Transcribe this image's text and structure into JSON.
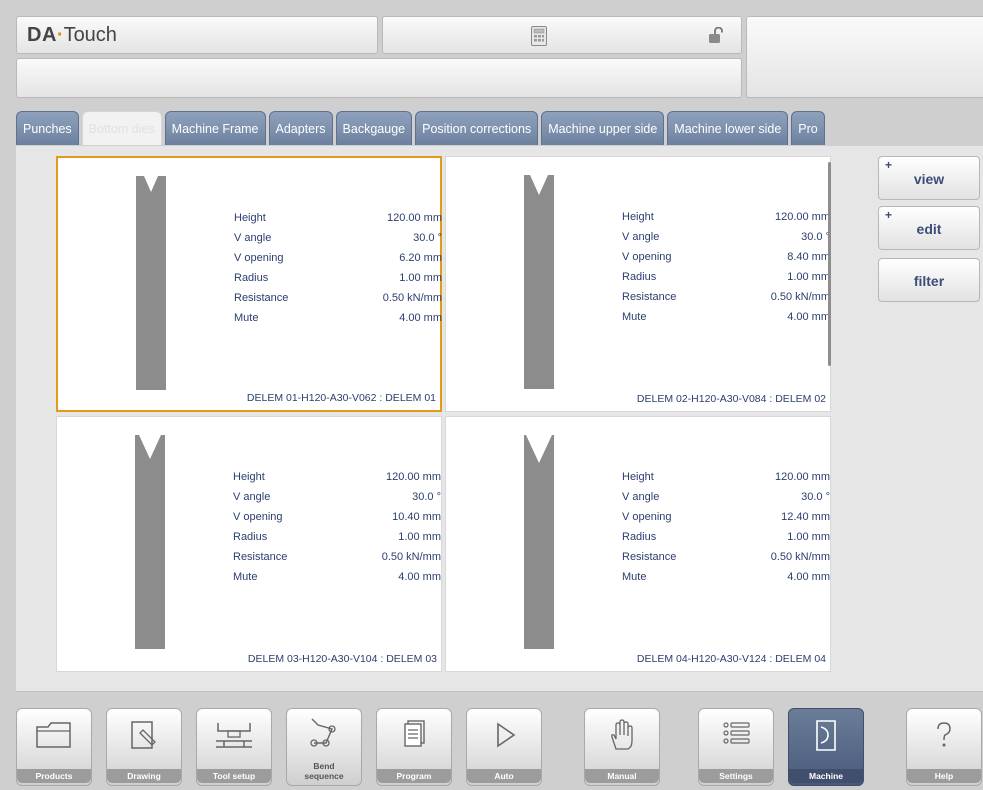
{
  "app": {
    "brand_prefix": "DA",
    "brand_separator": "·",
    "brand_suffix": "Touch"
  },
  "tabs": [
    {
      "label": "Punches"
    },
    {
      "label": "Bottom dies",
      "active": true
    },
    {
      "label": "Machine Frame"
    },
    {
      "label": "Adapters"
    },
    {
      "label": "Backgauge"
    },
    {
      "label": "Position corrections"
    },
    {
      "label": "Machine upper side"
    },
    {
      "label": "Machine lower side"
    },
    {
      "label": "Pro"
    }
  ],
  "prop_labels": {
    "height": "Height",
    "v_angle": "V angle",
    "v_opening": "V opening",
    "radius": "Radius",
    "resistance": "Resistance",
    "mute": "Mute"
  },
  "dies": [
    {
      "height": "120.00 mm",
      "v_angle": "30.0 °",
      "v_opening": "6.20 mm",
      "radius": "1.00 mm",
      "resistance": "0.50 kN/mm",
      "mute": "4.00 mm",
      "name": "DELEM 01-H120-A30-V062 : DELEM 01",
      "selected": true
    },
    {
      "height": "120.00 mm",
      "v_angle": "30.0 °",
      "v_opening": "8.40 mm",
      "radius": "1.00 mm",
      "resistance": "0.50 kN/mm",
      "mute": "4.00 mm",
      "name": "DELEM 02-H120-A30-V084 : DELEM 02"
    },
    {
      "height": "120.00 mm",
      "v_angle": "30.0 °",
      "v_opening": "10.40 mm",
      "radius": "1.00 mm",
      "resistance": "0.50 kN/mm",
      "mute": "4.00 mm",
      "name": "DELEM 03-H120-A30-V104 : DELEM 03"
    },
    {
      "height": "120.00 mm",
      "v_angle": "30.0 °",
      "v_opening": "12.40 mm",
      "radius": "1.00 mm",
      "resistance": "0.50 kN/mm",
      "mute": "4.00 mm",
      "name": "DELEM 04-H120-A30-V124 : DELEM 04"
    }
  ],
  "side_buttons": {
    "view": "view",
    "edit": "edit",
    "filter": "filter",
    "plus": "+"
  },
  "nav": [
    {
      "label": "Products",
      "icon": "folder-icon"
    },
    {
      "label": "Drawing",
      "icon": "drawing-icon"
    },
    {
      "label": "Tool setup",
      "icon": "tool-setup-icon"
    },
    {
      "label": "Bend sequence",
      "label_line1": "Bend",
      "label_line2": "sequence",
      "icon": "bend-sequence-icon"
    },
    {
      "label": "Program",
      "icon": "program-icon"
    },
    {
      "label": "Auto",
      "icon": "play-icon"
    },
    {
      "label": "Manual",
      "icon": "hand-icon"
    },
    {
      "label": "Settings",
      "icon": "settings-list-icon"
    },
    {
      "label": "Machine",
      "icon": "machine-icon",
      "active": true
    },
    {
      "label": "Help",
      "icon": "help-icon"
    }
  ],
  "colors": {
    "accent_selected": "#e29a1b",
    "tab_bg": "#7a8dab",
    "text_blue": "#2b3e6e",
    "brand_dot": "#e08a1e"
  }
}
